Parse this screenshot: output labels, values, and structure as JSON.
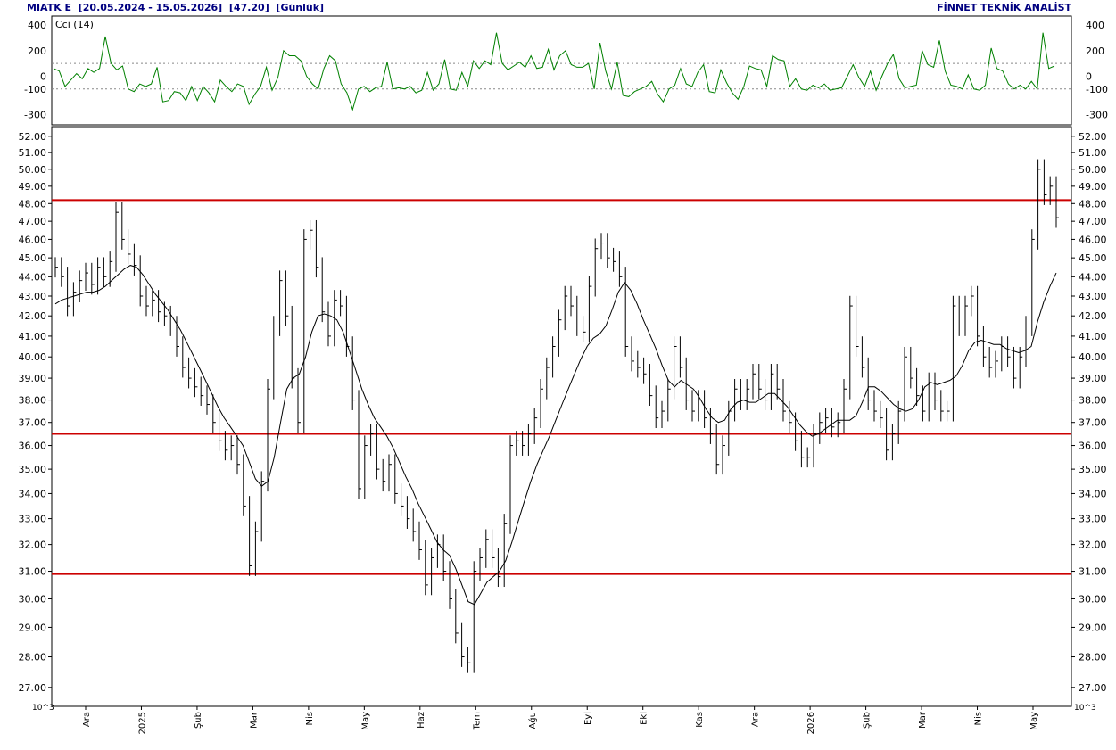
{
  "header": {
    "symbol": "MIATK E",
    "range": "[20.05.2024 - 15.05.2026]",
    "last_value": "[47.20]",
    "period": "[Günlük]",
    "provider": "FİNNET TEKNİK ANALİST"
  },
  "scale_note": "10^3",
  "colors": {
    "price": "#000000",
    "cci": "#008000",
    "support": "#cc0000",
    "frame": "#000000"
  },
  "chart_data": [
    {
      "type": "line",
      "name": "cci_panel",
      "legend": "Cci (14)",
      "ylim": [
        -380,
        470
      ],
      "yticks": [
        400,
        200,
        0,
        -100,
        -300
      ],
      "reference_lines": [
        100,
        -100
      ],
      "series": [
        {
          "name": "Cci (14)",
          "values": [
            60,
            40,
            -80,
            -30,
            20,
            -20,
            60,
            30,
            60,
            310,
            100,
            50,
            80,
            -100,
            -120,
            -60,
            -80,
            -60,
            70,
            -200,
            -190,
            -120,
            -130,
            -190,
            -80,
            -190,
            -80,
            -130,
            -200,
            -30,
            -80,
            -120,
            -60,
            -80,
            -220,
            -140,
            -80,
            70,
            -110,
            -10,
            200,
            160,
            160,
            120,
            0,
            -60,
            -100,
            60,
            160,
            120,
            -60,
            -130,
            -260,
            -100,
            -80,
            -120,
            -90,
            -80,
            110,
            -100,
            -90,
            -100,
            -80,
            -130,
            -110,
            30,
            -110,
            -60,
            130,
            -100,
            -110,
            30,
            -80,
            120,
            60,
            120,
            90,
            340,
            100,
            50,
            80,
            110,
            70,
            160,
            60,
            70,
            210,
            50,
            160,
            200,
            90,
            70,
            70,
            100,
            -100,
            260,
            40,
            -100,
            110,
            -150,
            -160,
            -120,
            -100,
            -80,
            -40,
            -140,
            -200,
            -100,
            -70,
            60,
            -60,
            -80,
            30,
            90,
            -120,
            -130,
            50,
            -50,
            -130,
            -180,
            -80,
            80,
            60,
            50,
            -80,
            160,
            130,
            120,
            -80,
            -20,
            -100,
            -110,
            -70,
            -90,
            -60,
            -110,
            -100,
            -90,
            0,
            90,
            -10,
            -80,
            40,
            -110,
            0,
            100,
            170,
            -20,
            -90,
            -80,
            -70,
            200,
            90,
            70,
            280,
            40,
            -70,
            -80,
            -100,
            10,
            -100,
            -110,
            -70,
            220,
            60,
            40,
            -60,
            -100,
            -70,
            -100,
            -40,
            -100,
            340,
            60,
            80
          ]
        }
      ]
    },
    {
      "type": "bar",
      "name": "price_panel",
      "subtype": "hlc-bars",
      "scale": "log",
      "ylim": [
        26.4,
        52.6
      ],
      "yticks": [
        "27.00",
        "28.00",
        "29.00",
        "30.00",
        "31.00",
        "32.00",
        "33.00",
        "34.00",
        "35.00",
        "36.00",
        "37.00",
        "38.00",
        "39.00",
        "40.00",
        "41.00",
        "42.00",
        "43.00",
        "44.00",
        "45.00",
        "46.00",
        "47.00",
        "48.00",
        "49.00",
        "50.00",
        "51.00",
        "52.00"
      ],
      "x_labels": [
        "Ara",
        "2025",
        "Şub",
        "Mar",
        "Nis",
        "May",
        "Haz",
        "Tem",
        "Ağu",
        "Eyl",
        "Eki",
        "Kas",
        "Ara",
        "2026",
        "Şub",
        "Mar",
        "Nis",
        "May"
      ],
      "horizontal_lines": [
        48.2,
        36.5,
        30.9
      ],
      "closes": [
        44.5,
        44.0,
        42.5,
        43.2,
        43.8,
        44.2,
        43.6,
        44.5,
        44.0,
        44.8,
        47.5,
        46.0,
        45.2,
        44.6,
        43.0,
        42.5,
        42.8,
        42.2,
        42.0,
        41.5,
        40.5,
        39.5,
        39.0,
        38.6,
        38.2,
        37.8,
        37.0,
        36.2,
        35.8,
        36.0,
        35.2,
        33.5,
        31.2,
        32.5,
        34.5,
        38.5,
        41.5,
        43.8,
        42.0,
        39.0,
        37.0,
        46.0,
        46.5,
        44.5,
        42.2,
        41.0,
        42.8,
        42.5,
        40.5,
        38.0,
        34.2,
        36.0,
        36.5,
        35.0,
        34.5,
        35.2,
        34.0,
        33.5,
        33.0,
        32.5,
        31.8,
        30.5,
        31.5,
        32.0,
        31.0,
        30.0,
        28.8,
        28.0,
        27.8,
        31.0,
        31.5,
        32.2,
        31.5,
        30.8,
        32.8,
        36.0,
        36.2,
        36.0,
        36.5,
        37.2,
        38.5,
        39.5,
        40.5,
        41.8,
        43.0,
        42.5,
        41.5,
        41.2,
        43.5,
        45.5,
        45.8,
        45.0,
        44.8,
        44.0,
        40.5,
        39.8,
        39.5,
        39.2,
        38.2,
        37.2,
        37.5,
        38.5,
        40.5,
        39.5,
        38.0,
        37.5,
        38.0,
        37.2,
        36.5,
        35.2,
        36.0,
        37.5,
        38.5,
        38.0,
        38.5,
        39.2,
        38.5,
        38.0,
        39.2,
        38.5,
        37.5,
        37.0,
        36.2,
        35.5,
        35.5,
        36.5,
        37.0,
        37.2,
        36.8,
        37.0,
        38.5,
        42.5,
        40.5,
        39.5,
        38.0,
        37.5,
        37.2,
        35.8,
        36.5,
        37.5,
        40.0,
        39.0,
        38.2,
        37.5,
        38.8,
        38.0,
        37.5,
        37.5,
        42.5,
        41.5,
        42.5,
        43.0,
        41.0,
        40.0,
        39.5,
        39.8,
        40.5,
        40.0,
        39.0,
        40.0,
        41.5,
        46.0,
        50.0,
        48.5,
        49.0,
        47.2
      ],
      "ma_values": [
        42.6,
        42.8,
        42.9,
        43.0,
        43.1,
        43.2,
        43.2,
        43.3,
        43.5,
        43.8,
        44.1,
        44.4,
        44.6,
        44.5,
        44.1,
        43.6,
        43.1,
        42.7,
        42.3,
        41.8,
        41.3,
        40.7,
        40.1,
        39.5,
        38.9,
        38.3,
        37.7,
        37.2,
        36.8,
        36.4,
        36.0,
        35.3,
        34.6,
        34.3,
        34.5,
        35.5,
        37.0,
        38.5,
        39.0,
        39.2,
        40.0,
        41.2,
        42.0,
        42.1,
        42.0,
        41.8,
        41.2,
        40.3,
        39.4,
        38.5,
        37.8,
        37.2,
        36.8,
        36.4,
        35.9,
        35.3,
        34.7,
        34.2,
        33.6,
        33.1,
        32.6,
        32.1,
        31.8,
        31.6,
        31.1,
        30.5,
        29.9,
        29.8,
        30.2,
        30.6,
        30.8,
        31.0,
        31.4,
        32.1,
        32.9,
        33.7,
        34.5,
        35.2,
        35.8,
        36.4,
        37.1,
        37.8,
        38.5,
        39.2,
        39.9,
        40.5,
        40.9,
        41.1,
        41.5,
        42.3,
        43.2,
        43.7,
        43.3,
        42.6,
        41.8,
        41.1,
        40.4,
        39.6,
        38.9,
        38.6,
        38.9,
        38.7,
        38.5,
        38.1,
        37.6,
        37.2,
        37.0,
        37.1,
        37.6,
        37.9,
        38.0,
        37.9,
        37.9,
        38.1,
        38.3,
        38.3,
        38.0,
        37.7,
        37.3,
        36.9,
        36.6,
        36.4,
        36.5,
        36.7,
        36.9,
        37.1,
        37.1,
        37.1,
        37.3,
        37.9,
        38.6,
        38.6,
        38.4,
        38.1,
        37.8,
        37.6,
        37.5,
        37.6,
        38.0,
        38.6,
        38.8,
        38.7,
        38.8,
        38.9,
        39.1,
        39.6,
        40.3,
        40.7,
        40.8,
        40.7,
        40.6,
        40.6,
        40.4,
        40.3,
        40.2,
        40.3,
        40.5,
        41.7,
        42.7,
        43.5,
        44.2
      ]
    }
  ]
}
